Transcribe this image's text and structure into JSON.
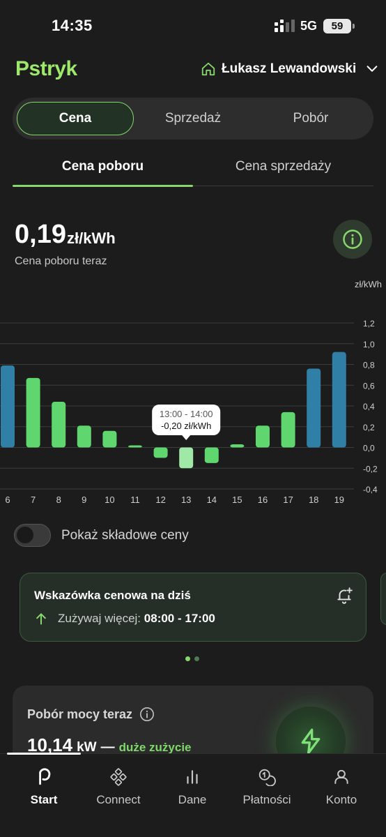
{
  "status_bar": {
    "time": "14:35",
    "network": "5G",
    "battery": "59"
  },
  "header": {
    "logo": "Pstryk",
    "user_name": "Łukasz Lewandowski"
  },
  "segments": [
    {
      "label": "Cena",
      "active": true
    },
    {
      "label": "Sprzedaż",
      "active": false
    },
    {
      "label": "Pobór",
      "active": false
    }
  ],
  "subtabs": [
    {
      "label": "Cena poboru",
      "active": true
    },
    {
      "label": "Cena sprzedaży",
      "active": false
    }
  ],
  "price": {
    "value": "0,19",
    "unit": "zł/kWh",
    "caption": "Cena poboru teraz"
  },
  "chart_data": {
    "type": "bar",
    "ylabel": "zł/kWh",
    "ylim": [
      -0.4,
      1.2
    ],
    "yticks": [
      "1,2",
      "1,0",
      "0,8",
      "0,6",
      "0,4",
      "0,2",
      "0,0",
      "-0,2",
      "-0,4"
    ],
    "categories": [
      "6",
      "7",
      "8",
      "9",
      "10",
      "11",
      "12",
      "13",
      "14",
      "15",
      "16",
      "17",
      "18",
      "19"
    ],
    "values": [
      0.79,
      0.67,
      0.44,
      0.21,
      0.16,
      0.02,
      -0.1,
      -0.2,
      -0.15,
      0.03,
      0.21,
      0.34,
      0.76,
      0.92
    ],
    "bar_colors": [
      "#2f7fa6",
      "#5fd66e",
      "#5fd66e",
      "#5fd66e",
      "#5fd66e",
      "#5fd66e",
      "#5fd66e",
      "#9fe8a6",
      "#5fd66e",
      "#5fd66e",
      "#5fd66e",
      "#5fd66e",
      "#2f7fa6",
      "#2f7fa6"
    ],
    "selected_index": 7,
    "tooltip": {
      "time": "13:00 - 14:00",
      "value": "-0,20 zł/kWh"
    },
    "grid": true
  },
  "toggle": {
    "label": "Pokaż składowe ceny",
    "on": false
  },
  "hint": {
    "title": "Wskazówka cenowa na dziś",
    "text": "Zużywaj więcej:",
    "hours": "08:00 - 17:00",
    "icons": {
      "bell": "bell-plus-icon",
      "arrow": "arrow-up-icon"
    }
  },
  "pagination": {
    "pages": 2,
    "active": 0
  },
  "power": {
    "title": "Pobór mocy teraz",
    "value": "10,14",
    "unit": "kW",
    "dash": "—",
    "status": "duże zużycie"
  },
  "nav": [
    {
      "label": "Start",
      "icon": "pstryk-p-icon",
      "active": true
    },
    {
      "label": "Connect",
      "icon": "connect-icon",
      "active": false
    },
    {
      "label": "Dane",
      "icon": "bar-chart-icon",
      "active": false
    },
    {
      "label": "Płatności",
      "icon": "coins-icon",
      "active": false
    },
    {
      "label": "Konto",
      "icon": "person-icon",
      "active": false
    }
  ],
  "colors": {
    "accent": "#88d76d",
    "bar_green": "#5fd66e",
    "bar_blue": "#2f7fa6",
    "background": "#1c1c1c"
  }
}
